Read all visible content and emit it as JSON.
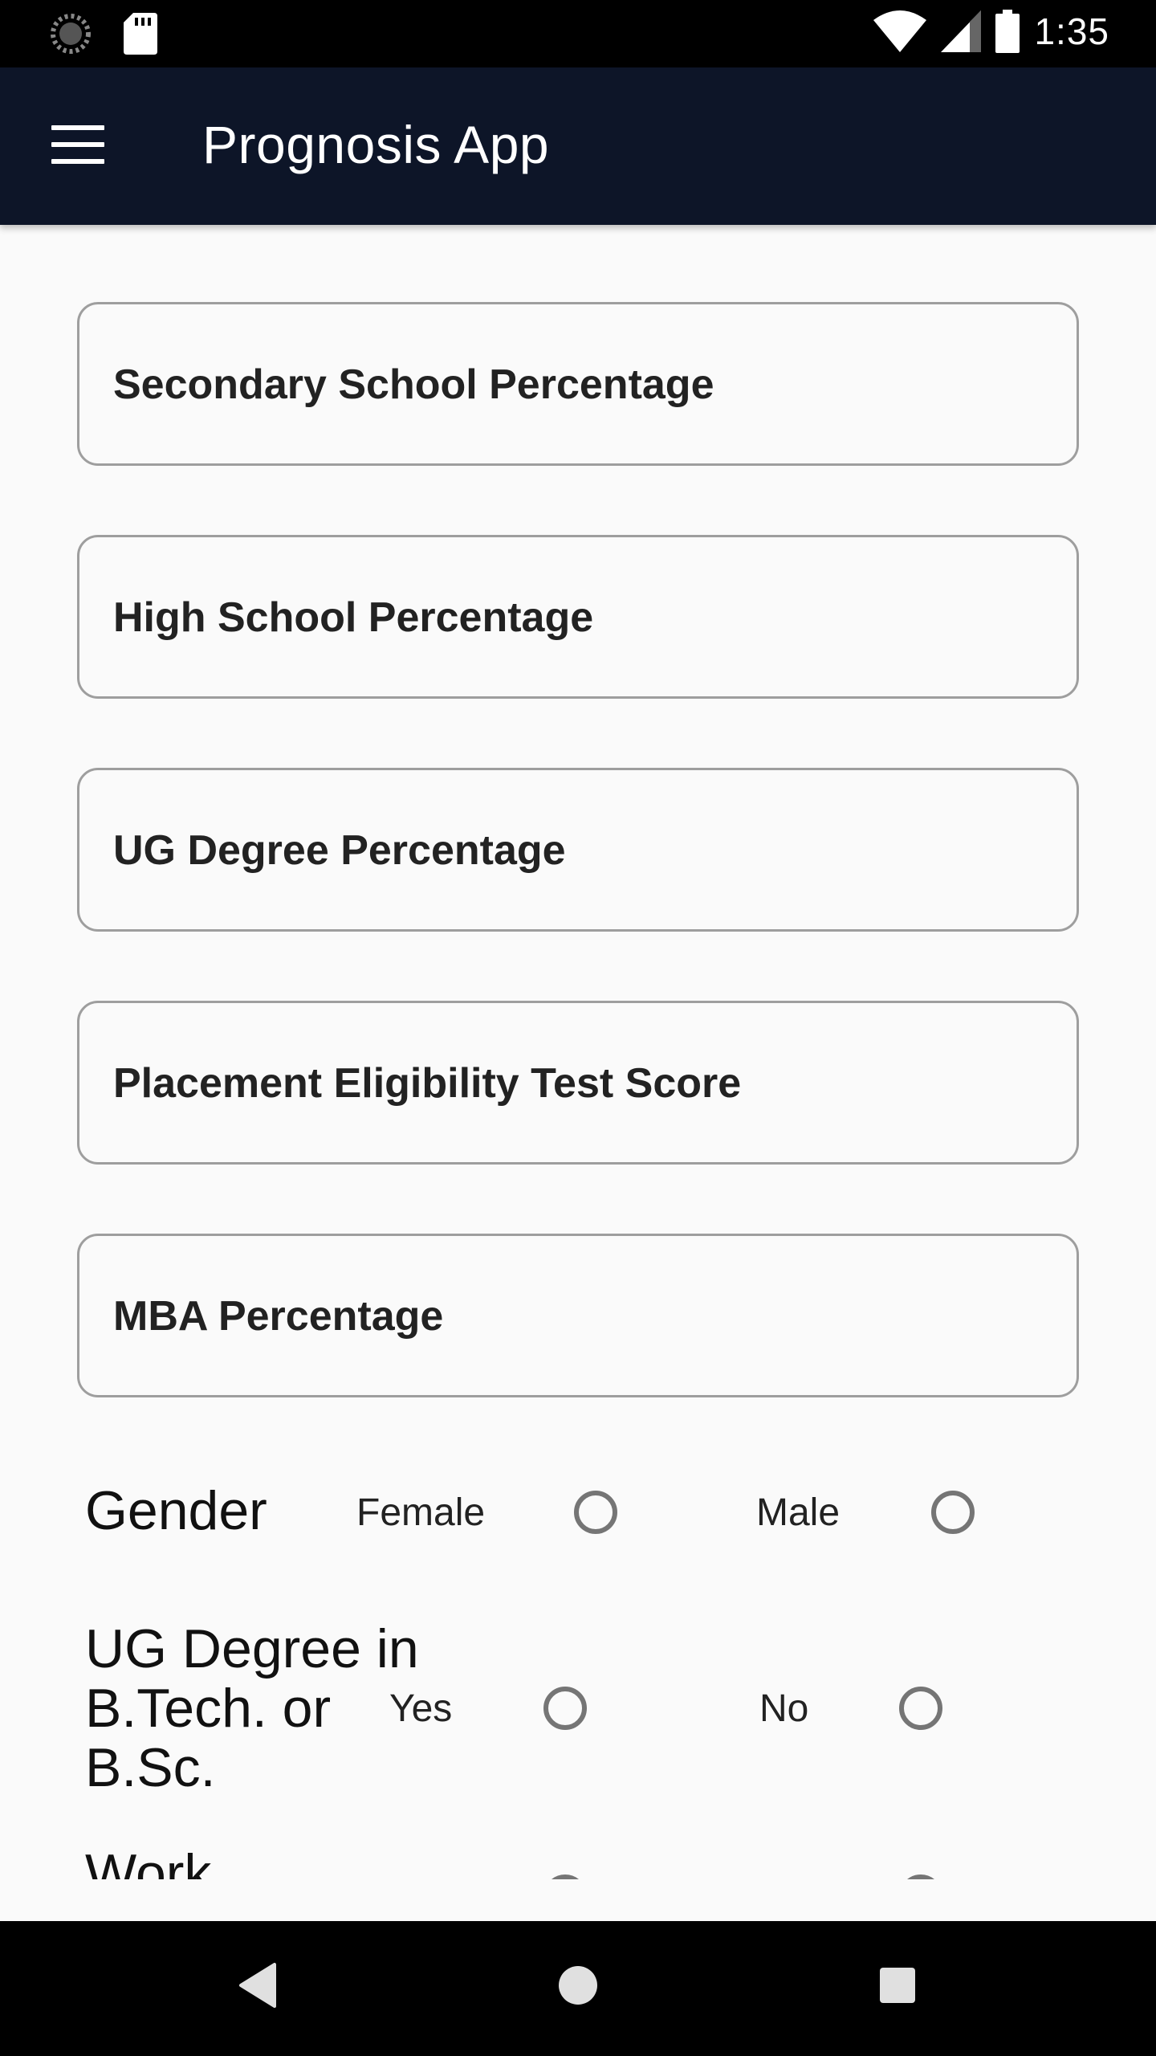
{
  "status_bar": {
    "time": "1:35",
    "icons": [
      "loading-icon",
      "sd-card-icon",
      "wifi-icon",
      "signal-icon",
      "battery-icon"
    ]
  },
  "app_bar": {
    "title": "Prognosis App",
    "menu_icon": "hamburger-menu-icon",
    "background": "#0d1528"
  },
  "form": {
    "fields": [
      {
        "placeholder": "Secondary School Percentage",
        "value": ""
      },
      {
        "placeholder": "High School Percentage",
        "value": ""
      },
      {
        "placeholder": "UG Degree Percentage",
        "value": ""
      },
      {
        "placeholder": "Placement Eligibility Test Score",
        "value": ""
      },
      {
        "placeholder": "MBA Percentage",
        "value": ""
      }
    ],
    "gender": {
      "label": "Gender",
      "option_1": "Female",
      "option_2": "Male",
      "selected": null
    },
    "ug_degree": {
      "label_line_1": "UG Degree in",
      "label_line_2": "B.Tech. or",
      "label_line_3": "B.Sc.",
      "option_1": "Yes",
      "option_2": "No",
      "selected": null
    },
    "work_exp": {
      "label_partial": "Work"
    }
  },
  "nav_bar": {
    "back": "back-triangle-icon",
    "home": "home-circle-icon",
    "recents": "recents-square-icon"
  }
}
